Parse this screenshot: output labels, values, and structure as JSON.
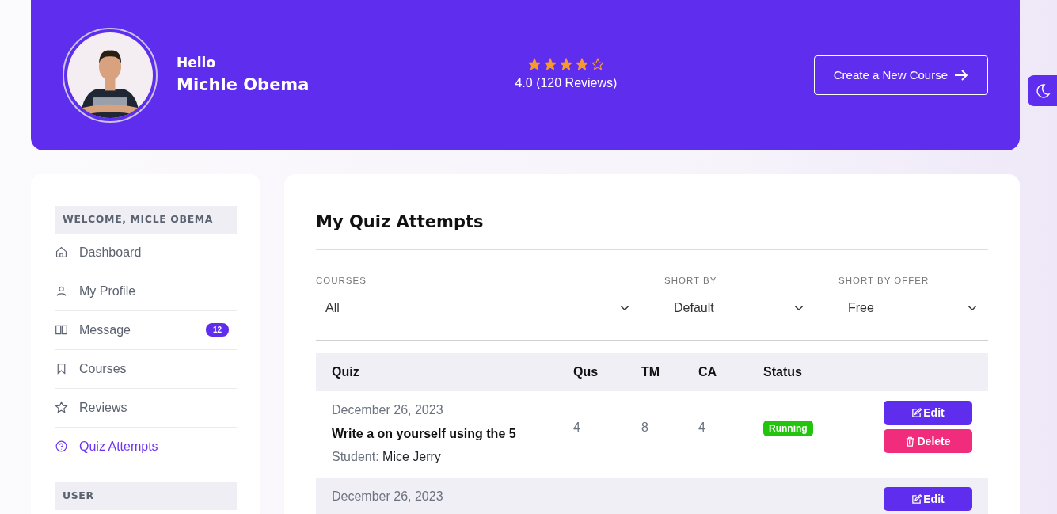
{
  "header": {
    "greeting": "Hello",
    "name": "Michle Obema",
    "stars": 4,
    "rating": "4.0 (120 Reviews)",
    "button": "Create a New Course"
  },
  "sidebar": {
    "sections": [
      {
        "title": "WELCOME, MICLE OBEMA",
        "items": [
          {
            "label": "Dashboard",
            "selected": false
          },
          {
            "label": "My Profile",
            "selected": false
          },
          {
            "label": "Message",
            "badge": "12",
            "selected": false
          },
          {
            "label": "Courses",
            "selected": false
          },
          {
            "label": "Reviews",
            "selected": false
          },
          {
            "label": "Quiz Attempts",
            "selected": true
          }
        ]
      },
      {
        "title": "USER"
      }
    ]
  },
  "main": {
    "title": "My Quiz Attempts",
    "filters": [
      {
        "label": "COURSES",
        "value": "All"
      },
      {
        "label": "SHORT BY",
        "value": "Default"
      },
      {
        "label": "SHORT BY OFFER",
        "value": "Free"
      }
    ],
    "table": {
      "columns": [
        "Quiz",
        "Qus",
        "TM",
        "CA",
        "Status"
      ],
      "rows": [
        {
          "date": "December 26, 2023",
          "title": "Write a on yourself using the 5",
          "student_label": "Student:",
          "student": "Mice Jerry",
          "qus": "4",
          "tm": "8",
          "ca": "4",
          "status": "Running",
          "actions": [
            {
              "kind": "edit",
              "label": "Edit"
            },
            {
              "kind": "delete",
              "label": "Delete"
            }
          ]
        },
        {
          "date": "December 26, 2023",
          "actions": [
            {
              "kind": "edit",
              "label": "Edit"
            }
          ]
        }
      ]
    }
  }
}
